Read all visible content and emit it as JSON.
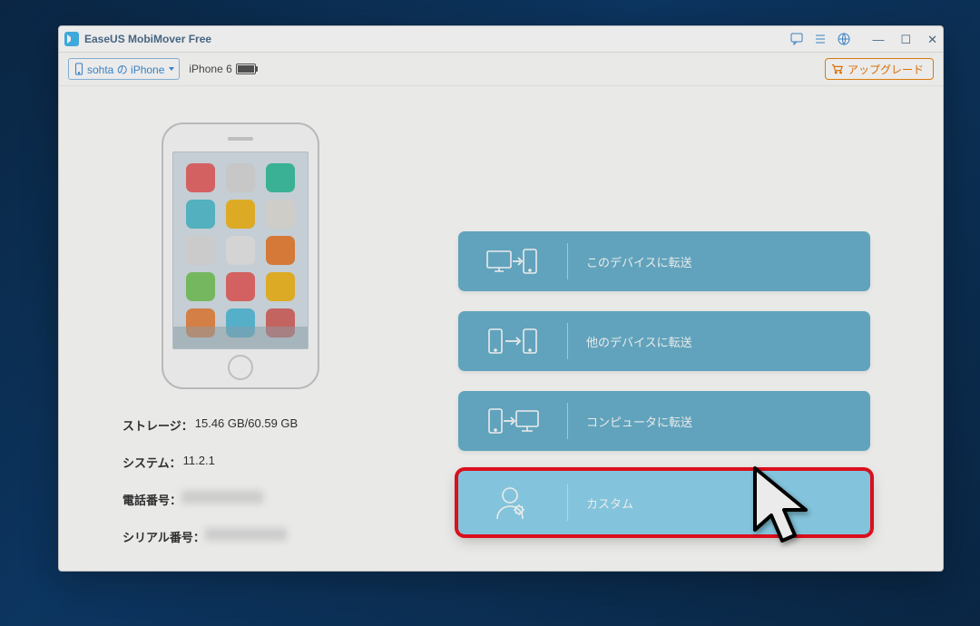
{
  "app": {
    "title": "EaseUS MobiMover Free"
  },
  "device_selector": {
    "label": "sohta の iPhone"
  },
  "device_model": "iPhone 6",
  "upgrade": {
    "label": "アップグレード"
  },
  "info": {
    "storage_label": "ストレージ：",
    "storage_value": "15.46 GB/60.59 GB",
    "system_label": "システム：",
    "system_value": "11.2.1",
    "phone_label": "電話番号：",
    "serial_label": "シリアル番号："
  },
  "actions": {
    "to_this_device": "このデバイスに転送",
    "to_other_device": "他のデバイスに転送",
    "to_computer": "コンピュータに転送",
    "custom": "カスタム"
  }
}
